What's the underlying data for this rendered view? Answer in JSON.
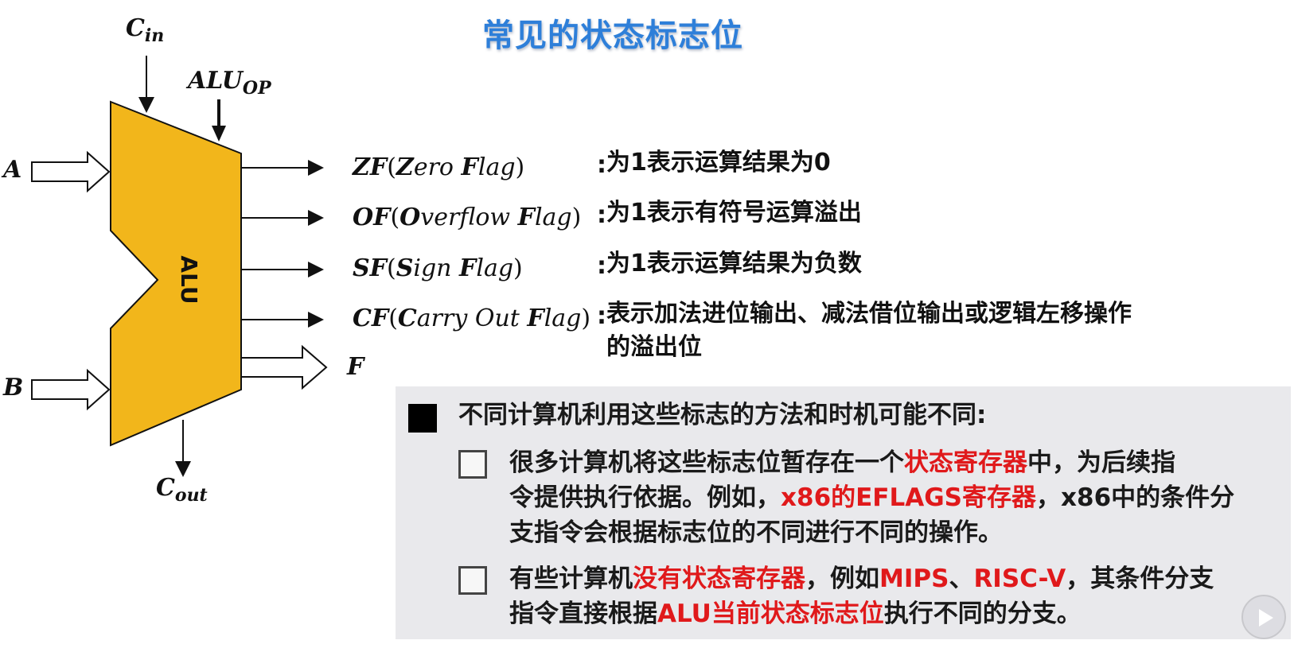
{
  "title": "常见的状态标志位",
  "diagram": {
    "cin_main": "C",
    "cin_sub": "in",
    "aluop_main": "ALU",
    "aluop_sub": "OP",
    "input_a": "A",
    "input_b": "B",
    "alu_label": "ALU",
    "cout_main": "C",
    "cout_sub": "out",
    "output_f": "F",
    "alu_fill": "#f2b61b"
  },
  "flags": [
    {
      "abbr": "ZF",
      "open": "(",
      "w1_first": "Z",
      "w1_rest": "ero",
      "w2_first": "F",
      "w2_rest": "lag",
      "extra": "",
      "close": ")",
      "colon": ":",
      "desc": "为1表示运算结果为0"
    },
    {
      "abbr": "OF",
      "open": "(",
      "w1_first": "O",
      "w1_rest": "verflow",
      "w2_first": "F",
      "w2_rest": "lag",
      "extra": "",
      "close": ")",
      "colon": ":",
      "desc": "为1表示有符号运算溢出"
    },
    {
      "abbr": "SF",
      "open": "(",
      "w1_first": "S",
      "w1_rest": "ign",
      "w2_first": "F",
      "w2_rest": "lag",
      "extra": "",
      "close": ")",
      "colon": ":",
      "desc": "为1表示运算结果为负数"
    },
    {
      "abbr": "CF",
      "open": "(",
      "w1_first": "C",
      "w1_rest": "arry Out",
      "w2_first": "F",
      "w2_rest": "lag",
      "extra": "",
      "close": ")",
      "colon": ":",
      "desc": "表示加法进位输出、减法借位输出或逻辑左移操作",
      "desc2": "的溢出位"
    }
  ],
  "notes": {
    "heading": "不同计算机利用这些标志的方法和时机可能不同:",
    "item1": {
      "l1a": "很多计算机将这些标志位暂存在一个",
      "l1b": "状态寄存器",
      "l1c": "中，为后续指",
      "l2a": "令提供执行依据。例如，",
      "l2b": "x86的EFLAGS寄存器",
      "l2c": "，x86中的条件分",
      "l3": "支指令会根据标志位的不同进行不同的操作。"
    },
    "item2": {
      "l1a": "有些计算机",
      "l1b": "没有状态寄存器",
      "l1c": "，例如",
      "l1d": "MIPS",
      "l1e": "、",
      "l1f": "RISC-V",
      "l1g": "，其条件分支",
      "l2a": "指令直接根据",
      "l2b": "ALU当前状态标志位",
      "l2c": "执行不同的分支。"
    }
  },
  "colors": {
    "title": "#2e7fd9",
    "highlight": "#e0191b",
    "alu": "#f2b61b",
    "note_bg": "#e9e9ec"
  },
  "icons": {
    "play": "play-icon"
  }
}
